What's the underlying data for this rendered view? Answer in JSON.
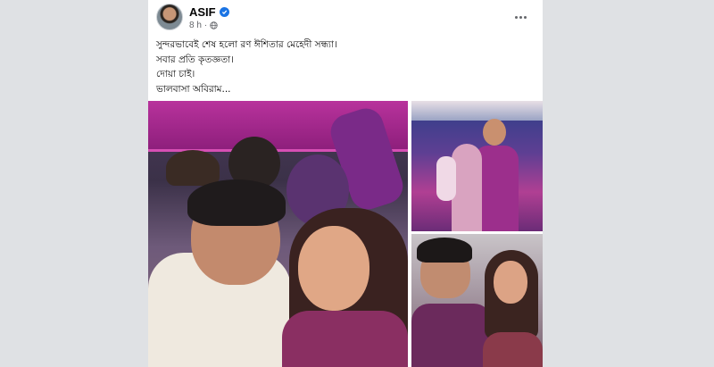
{
  "post": {
    "author": "ASIF",
    "verified": true,
    "time": "8 h",
    "separator": "·",
    "audience_icon": "globe-icon",
    "more_icon": "more-options-icon",
    "text_lines": [
      "সুন্দরভাবেই শেষ হলো রণ ঈশিতার মেহেদী সন্ধ্যা।",
      "সবার প্রতি কৃতজ্ঞতা।",
      "দোয়া চাই।",
      "ভালবাসা অবিরাম..."
    ]
  },
  "colors": {
    "page_bg": "#dfe1e4",
    "card_bg": "#ffffff",
    "verified_badge": "#1b74e4",
    "meta_text": "#65676b",
    "accent_magenta": "#9c2f8c"
  }
}
